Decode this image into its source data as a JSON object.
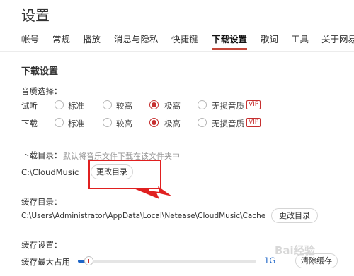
{
  "header": {
    "title": "设置"
  },
  "tabs": [
    {
      "label": "帐号"
    },
    {
      "label": "常规"
    },
    {
      "label": "播放"
    },
    {
      "label": "消息与隐私"
    },
    {
      "label": "快捷键"
    },
    {
      "label": "下载设置",
      "active": true
    },
    {
      "label": "歌词"
    },
    {
      "label": "工具"
    },
    {
      "label": "关于网易"
    }
  ],
  "download": {
    "section_title": "下载设置",
    "quality_label": "音质选择：",
    "rows": [
      {
        "label": "试听",
        "selected": "极高"
      },
      {
        "label": "下载",
        "selected": "极高"
      }
    ],
    "options": [
      "标准",
      "较高",
      "极高",
      "无损音质"
    ],
    "vip_badge": "VIP",
    "dir_label": "下载目录：",
    "dir_hint": "默认将音乐文件下载在该文件夹中",
    "dir_path": "C:\\CloudMusic",
    "change_dir_button": "更改目录"
  },
  "cache": {
    "dir_label": "缓存目录：",
    "dir_path": "C:\\Users\\Administrator\\AppData\\Local\\Netease\\CloudMusic\\Cache",
    "change_dir_button": "更改目录",
    "settings_label": "缓存设置：",
    "max_label": "缓存最大占用",
    "max_value": "1G",
    "slider_fraction": 0.06,
    "clear_button": "清除缓存"
  },
  "watermark": {
    "text": "Bai经验"
  },
  "colors": {
    "accent": "#c62f2f",
    "annotation": "#e02020",
    "slider": "#1e66c8"
  }
}
